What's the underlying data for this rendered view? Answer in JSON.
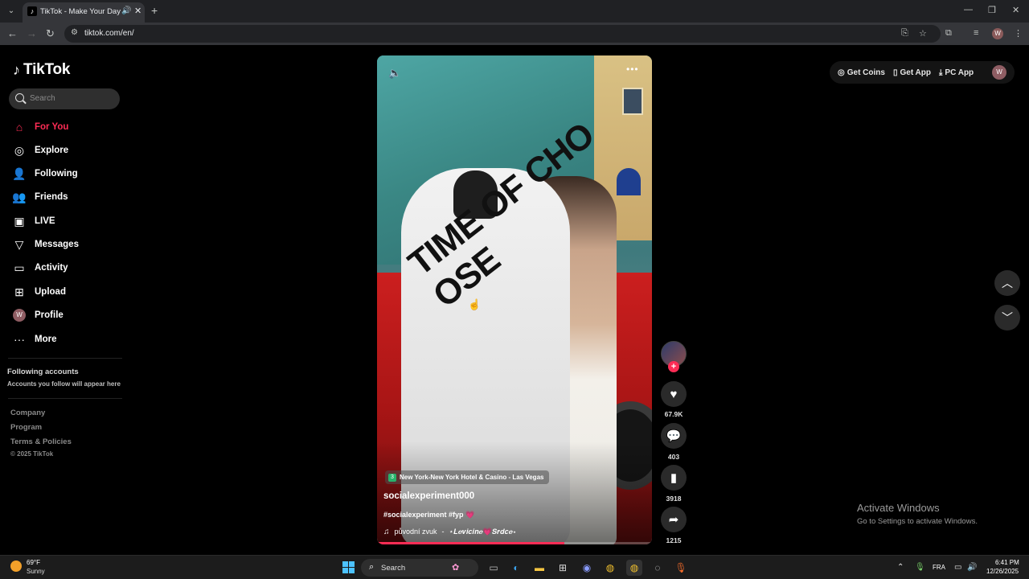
{
  "browser": {
    "tab_title": "TikTok - Make Your Day",
    "url": "tiktok.com/en/",
    "profile_initial": "W"
  },
  "sidebar": {
    "logo_text": "TikTok",
    "search_placeholder": "Search",
    "items": [
      {
        "label": "For You",
        "icon": "home-icon",
        "active": true
      },
      {
        "label": "Explore",
        "icon": "compass-icon",
        "active": false
      },
      {
        "label": "Following",
        "icon": "following-icon",
        "active": false
      },
      {
        "label": "Friends",
        "icon": "friends-icon",
        "active": false
      },
      {
        "label": "LIVE",
        "icon": "live-icon",
        "active": false
      },
      {
        "label": "Messages",
        "icon": "messages-icon",
        "active": false
      },
      {
        "label": "Activity",
        "icon": "activity-icon",
        "active": false
      },
      {
        "label": "Upload",
        "icon": "upload-icon",
        "active": false
      },
      {
        "label": "Profile",
        "icon": "profile-avatar",
        "active": false
      },
      {
        "label": "More",
        "icon": "more-icon",
        "active": false
      }
    ],
    "profile_initial": "W",
    "following_title": "Following accounts",
    "following_sub": "Accounts you follow will appear here",
    "footer": [
      "Company",
      "Program",
      "Terms & Policies"
    ],
    "copyright": "© 2025 TikTok"
  },
  "video": {
    "hoodie_text": "TIME OF CHO OSE",
    "location": "New York-New York Hotel & Casino - Las Vegas",
    "author": "socialexperiment000",
    "caption": "#socialexperiment #fyp",
    "caption_emoji": "💗",
    "sound_original": "původní zvuk",
    "sound_separator": "-",
    "sound_author": "⋆𝑳𝒆𝒗𝒊𝒄𝒊𝒏𝒆💗𝑺𝒓𝒅𝒄𝒆⋆",
    "progress": 0.68
  },
  "actions": {
    "likes": "67.9K",
    "comments": "403",
    "saves": "3918",
    "shares": "1215"
  },
  "topbar": {
    "get_coins": "Get Coins",
    "get_app": "Get App",
    "pc_app": "PC App",
    "user_initial": "W"
  },
  "watermark": {
    "title": "Activate Windows",
    "subtitle": "Go to Settings to activate Windows."
  },
  "taskbar": {
    "temp": "69°F",
    "condition": "Sunny",
    "search_label": "Search",
    "language": "FRA",
    "time": "6:41 PM",
    "date": "12/26/2025"
  },
  "colors": {
    "accent": "#fe2c55",
    "background": "#000000"
  }
}
